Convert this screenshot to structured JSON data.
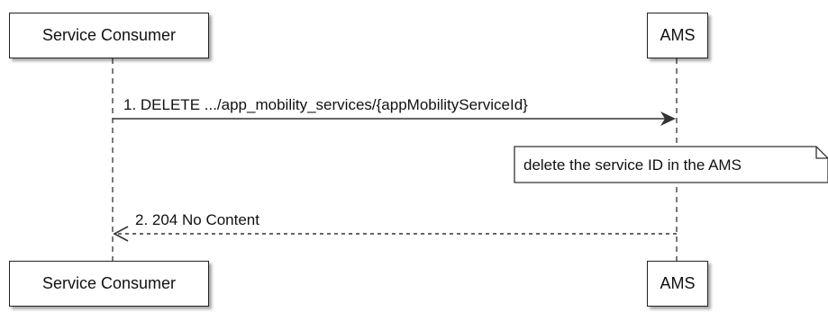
{
  "participants": {
    "consumer": "Service Consumer",
    "ams": "AMS"
  },
  "messages": [
    {
      "label": "1. DELETE .../app_mobility_services/{appMobilityServiceId}",
      "style": "solid",
      "direction": "consumer-to-ams"
    },
    {
      "label": "2. 204 No Content",
      "style": "dashed",
      "direction": "ams-to-consumer"
    }
  ],
  "note": {
    "text": "delete the service ID in the AMS",
    "attached_to": "ams"
  }
}
